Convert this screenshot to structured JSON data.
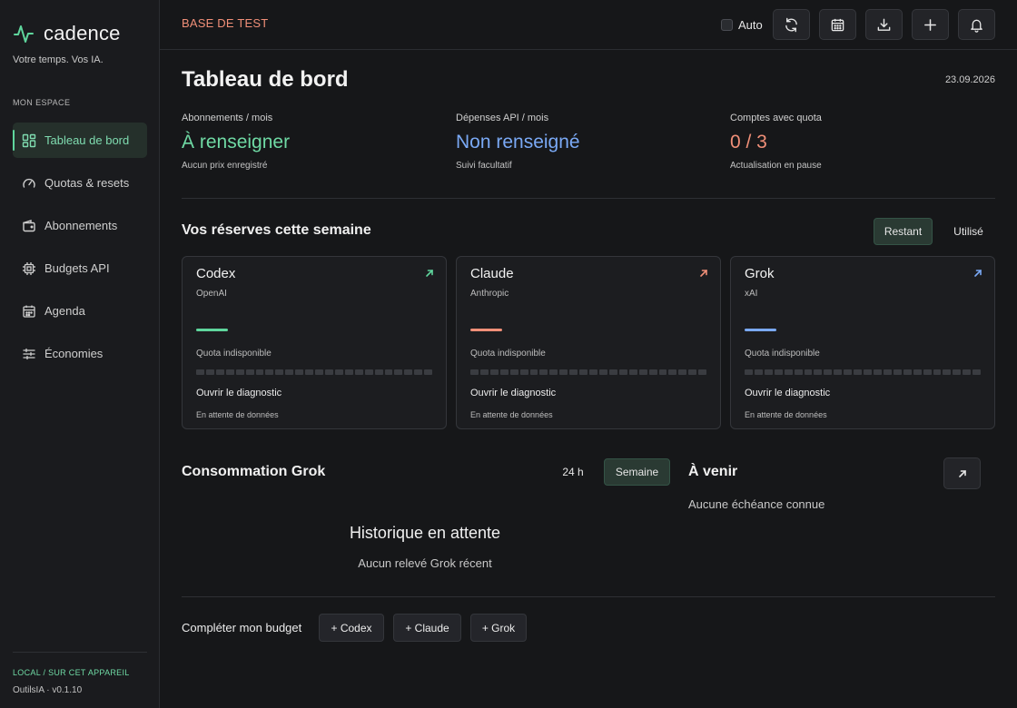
{
  "brand": {
    "name": "cadence",
    "tagline": "Votre temps. Vos IA.",
    "accent": "#5fd69d"
  },
  "sidebar": {
    "section_label": "MON ESPACE",
    "items": [
      {
        "label": "Tableau de bord",
        "icon": "dashboard-icon",
        "active": true
      },
      {
        "label": "Quotas & resets",
        "icon": "gauge-icon"
      },
      {
        "label": "Abonnements",
        "icon": "wallet-icon"
      },
      {
        "label": "Budgets API",
        "icon": "chip-icon"
      },
      {
        "label": "Agenda",
        "icon": "calendar-icon"
      },
      {
        "label": "Économies",
        "icon": "sliders-icon"
      }
    ],
    "footer": {
      "local_label": "LOCAL / SUR CET APPAREIL",
      "version": "OutilsIA · v0.1.10"
    }
  },
  "topbar": {
    "env_label": "BASE DE TEST",
    "auto_label": "Auto",
    "buttons": [
      "refresh-icon",
      "calendar-icon",
      "download-icon",
      "plus-icon",
      "bell-icon"
    ]
  },
  "page": {
    "title": "Tableau de bord",
    "date": "23.09.2026"
  },
  "kpis": [
    {
      "label": "Abonnements / mois",
      "value": "À renseigner",
      "sub": "Aucun prix enregistré",
      "color": "#6fd9a4"
    },
    {
      "label": "Dépenses API / mois",
      "value": "Non renseigné",
      "sub": "Suivi facultatif",
      "color": "#7aa9f5"
    },
    {
      "label": "Comptes avec quota",
      "value": "0 / 3",
      "sub": "Actualisation en pause",
      "color": "#f08f78"
    }
  ],
  "reserves": {
    "title": "Vos réserves cette semaine",
    "toggle": {
      "remaining": "Restant",
      "used": "Utilisé",
      "active": "remaining"
    },
    "cards": [
      {
        "name": "Codex",
        "vendor": "OpenAI",
        "color": "#5fd69d",
        "quota_text": "Quota indisponible",
        "link": "Ouvrir le diagnostic",
        "status": "En attente de données"
      },
      {
        "name": "Claude",
        "vendor": "Anthropic",
        "color": "#f08f78",
        "quota_text": "Quota indisponible",
        "link": "Ouvrir le diagnostic",
        "status": "En attente de données"
      },
      {
        "name": "Grok",
        "vendor": "xAI",
        "color": "#7aa9f5",
        "quota_text": "Quota indisponible",
        "link": "Ouvrir le diagnostic",
        "status": "En attente de données"
      }
    ]
  },
  "consumption": {
    "title": "Consommation Grok",
    "range_24h": "24 h",
    "range_week": "Semaine",
    "active_range": "week",
    "empty_title": "Historique en attente",
    "empty_sub": "Aucun relevé Grok récent"
  },
  "upcoming": {
    "title": "À venir",
    "empty": "Aucune échéance connue"
  },
  "budget": {
    "label": "Compléter mon budget",
    "chips": [
      "+ Codex",
      "+ Claude",
      "+ Grok"
    ]
  }
}
